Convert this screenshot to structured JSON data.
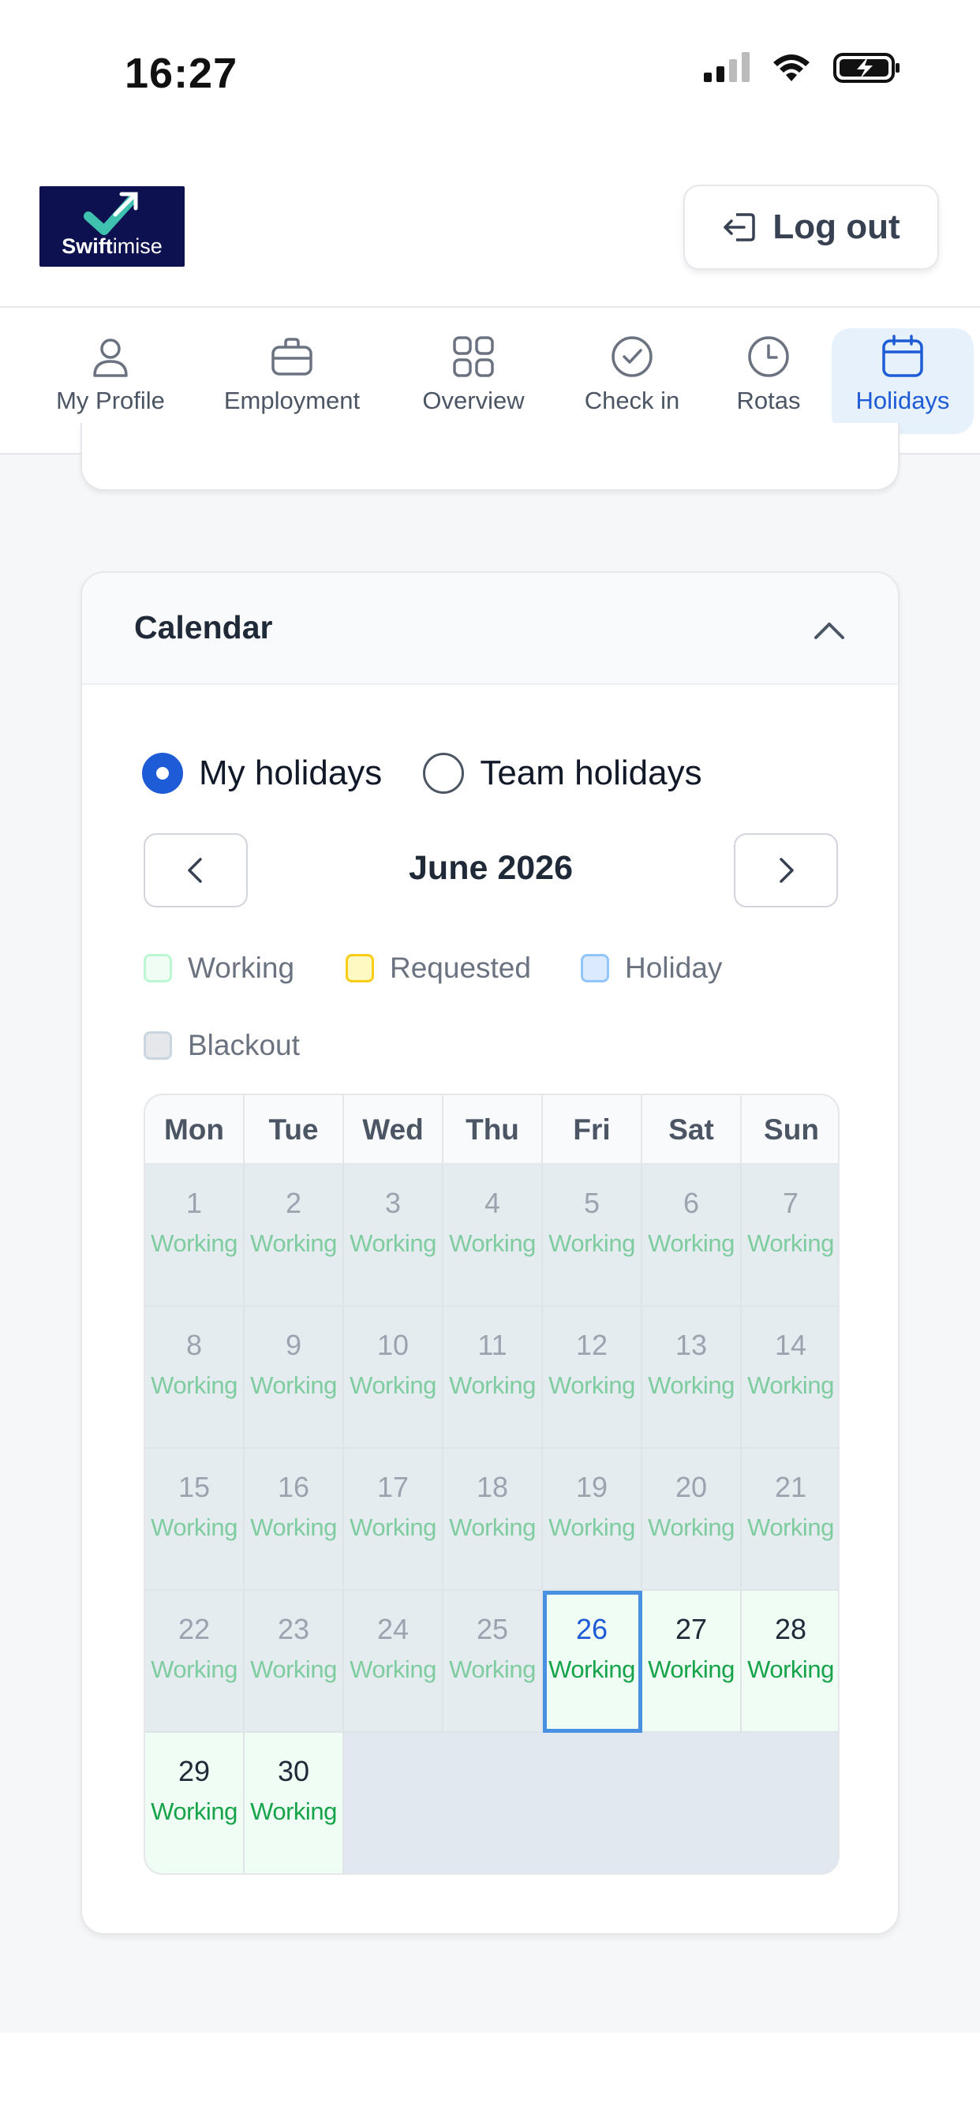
{
  "status_bar": {
    "time": "16:27"
  },
  "header": {
    "logo": {
      "brand_bold": "Swift",
      "brand_rest": "imise"
    },
    "logout_label": "Log out"
  },
  "nav": {
    "items": [
      {
        "label": "My Profile",
        "icon": "person-icon"
      },
      {
        "label": "Employment",
        "icon": "briefcase-icon"
      },
      {
        "label": "Overview",
        "icon": "grid-icon"
      },
      {
        "label": "Check in",
        "icon": "check-circle-icon"
      },
      {
        "label": "Rotas",
        "icon": "clock-icon"
      },
      {
        "label": "Holidays",
        "icon": "calendar-icon",
        "active": true
      }
    ]
  },
  "calendar": {
    "title": "Calendar",
    "view_options": [
      {
        "label": "My holidays",
        "selected": true
      },
      {
        "label": "Team holidays",
        "selected": false
      }
    ],
    "month_label": "June 2026",
    "legend": [
      {
        "label": "Working",
        "fill": "#f0fdf4",
        "border": "#bbf7d0"
      },
      {
        "label": "Requested",
        "fill": "#fef9c3",
        "border": "#facc15"
      },
      {
        "label": "Holiday",
        "fill": "#dbeafe",
        "border": "#93c5fd"
      },
      {
        "label": "Blackout",
        "fill": "#e5e7eb",
        "border": "#cbd5e1"
      }
    ],
    "weekdays": [
      "Mon",
      "Tue",
      "Wed",
      "Thu",
      "Fri",
      "Sat",
      "Sun"
    ],
    "days": [
      {
        "day": "1",
        "status": "Working",
        "state": "past"
      },
      {
        "day": "2",
        "status": "Working",
        "state": "past"
      },
      {
        "day": "3",
        "status": "Working",
        "state": "past"
      },
      {
        "day": "4",
        "status": "Working",
        "state": "past"
      },
      {
        "day": "5",
        "status": "Working",
        "state": "past"
      },
      {
        "day": "6",
        "status": "Working",
        "state": "past"
      },
      {
        "day": "7",
        "status": "Working",
        "state": "past"
      },
      {
        "day": "8",
        "status": "Working",
        "state": "past"
      },
      {
        "day": "9",
        "status": "Working",
        "state": "past"
      },
      {
        "day": "10",
        "status": "Working",
        "state": "past"
      },
      {
        "day": "11",
        "status": "Working",
        "state": "past"
      },
      {
        "day": "12",
        "status": "Working",
        "state": "past"
      },
      {
        "day": "13",
        "status": "Working",
        "state": "past"
      },
      {
        "day": "14",
        "status": "Working",
        "state": "past"
      },
      {
        "day": "15",
        "status": "Working",
        "state": "past"
      },
      {
        "day": "16",
        "status": "Working",
        "state": "past"
      },
      {
        "day": "17",
        "status": "Working",
        "state": "past"
      },
      {
        "day": "18",
        "status": "Working",
        "state": "past"
      },
      {
        "day": "19",
        "status": "Working",
        "state": "past"
      },
      {
        "day": "20",
        "status": "Working",
        "state": "past"
      },
      {
        "day": "21",
        "status": "Working",
        "state": "past"
      },
      {
        "day": "22",
        "status": "Working",
        "state": "past"
      },
      {
        "day": "23",
        "status": "Working",
        "state": "past"
      },
      {
        "day": "24",
        "status": "Working",
        "state": "past"
      },
      {
        "day": "25",
        "status": "Working",
        "state": "past"
      },
      {
        "day": "26",
        "status": "Working",
        "state": "today"
      },
      {
        "day": "27",
        "status": "Working",
        "state": "future"
      },
      {
        "day": "28",
        "status": "Working",
        "state": "future"
      },
      {
        "day": "29",
        "status": "Working",
        "state": "future"
      },
      {
        "day": "30",
        "status": "Working",
        "state": "future"
      }
    ]
  }
}
